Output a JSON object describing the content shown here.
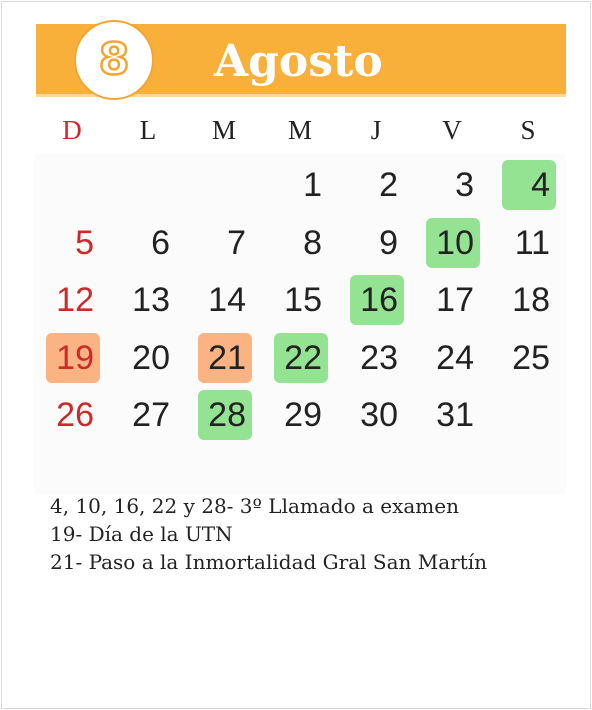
{
  "header": {
    "month_number": "8",
    "month_name": "Agosto"
  },
  "weekdays": [
    "D",
    "L",
    "M",
    "M",
    "J",
    "V",
    "S"
  ],
  "calendar": {
    "first_weekday_index": 3,
    "days_in_month": 31,
    "highlighted": {
      "green": [
        4,
        10,
        16,
        22,
        28
      ],
      "orange": [
        19,
        21
      ]
    },
    "colors": {
      "header": "#f9b03b",
      "green": "#94e393",
      "orange": "#fbb383",
      "sunday": "#cc2a2a"
    }
  },
  "notes": [
    "4, 10, 16, 22 y 28- 3º Llamado a examen",
    "19- Día de la UTN",
    "21- Paso a la Inmortalidad Gral San Martín"
  ]
}
